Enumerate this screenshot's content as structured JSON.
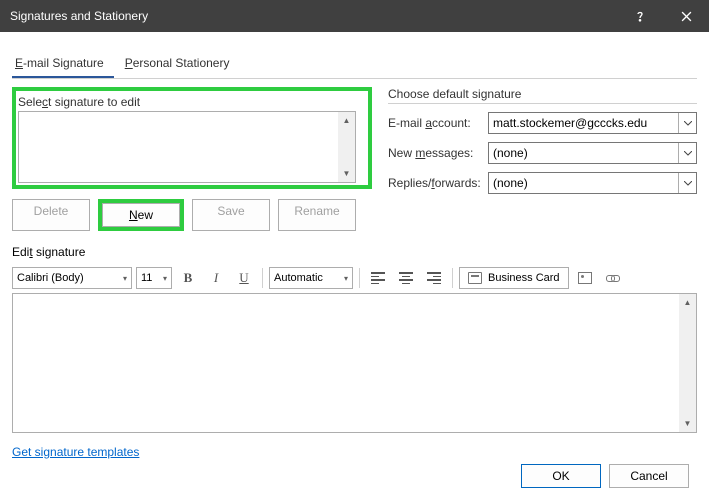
{
  "window": {
    "title": "Signatures and Stationery"
  },
  "tabs": {
    "email": "E-mail Signature",
    "personal": "Personal Stationery"
  },
  "select_section": {
    "label": "Select signature to edit"
  },
  "buttons": {
    "delete": "Delete",
    "new": "New",
    "save": "Save",
    "rename": "Rename"
  },
  "default_sig": {
    "title": "Choose default signature",
    "email_account_label": "E-mail account:",
    "email_account_value": "matt.stockemer@gcccks.edu",
    "new_messages_label": "New messages:",
    "new_messages_value": "(none)",
    "replies_label": "Replies/forwards:",
    "replies_value": "(none)"
  },
  "edit_section": {
    "label": "Edit signature",
    "font": "Calibri (Body)",
    "size": "11",
    "color": "Automatic",
    "biz_card": "Business Card"
  },
  "link": "Get signature templates",
  "footer": {
    "ok": "OK",
    "cancel": "Cancel"
  }
}
